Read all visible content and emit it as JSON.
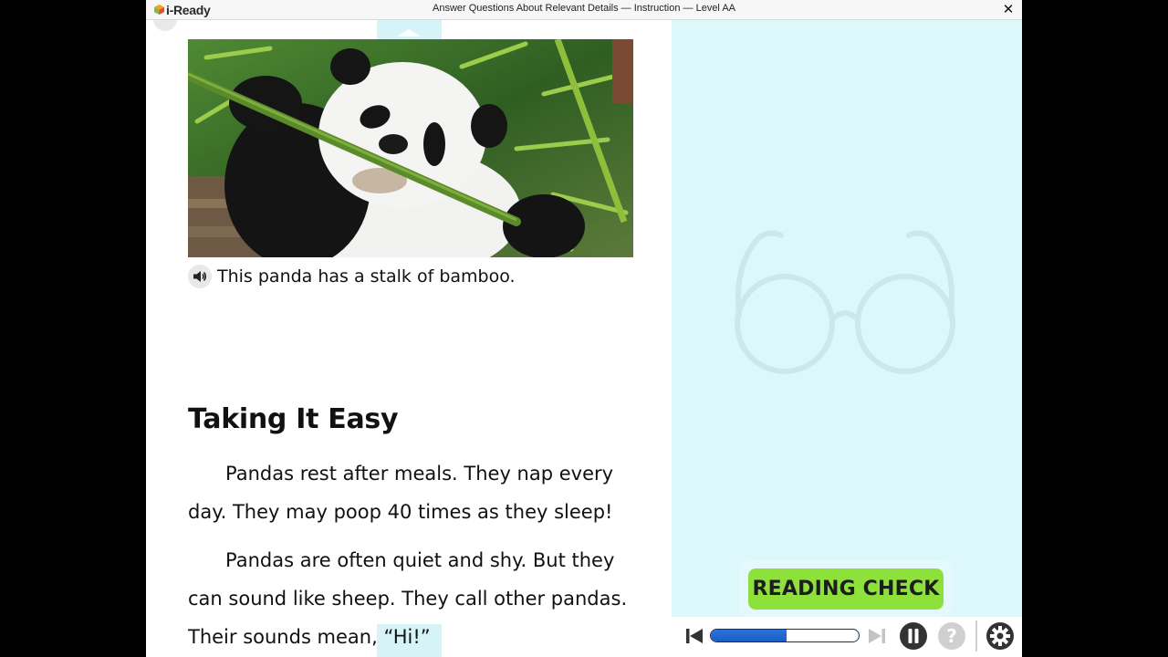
{
  "titlebar": {
    "logo_text": "i-Ready",
    "window_title": "Answer Questions About Relevant Details — Instruction — Level AA",
    "close_glyph": "✕"
  },
  "reading": {
    "image_caption": "This panda has a stalk of bamboo.",
    "heading": "Taking It Easy",
    "paragraphs": [
      "Pandas rest after meals. They nap every day. They may poop 40 times as they sleep!",
      "Pandas are often quiet and shy. But they can sound like sheep. They call other pandas. Their sounds mean, “Hi!”"
    ]
  },
  "side_panel": {
    "reading_check_label": "READING CHECK"
  },
  "controls": {
    "progress": 0.51
  },
  "icons": {
    "logo": "i-ready-cube-logo",
    "close": "close-icon",
    "audio": "speaker-icon",
    "prev": "skip-back-icon",
    "next": "skip-forward-icon",
    "pause": "pause-icon",
    "help": "help-icon",
    "settings": "gear-icon",
    "decor": "glasses-icon"
  },
  "colors": {
    "side_panel_bg": "#dcf8fb",
    "reading_check_bg": "#8ee03a",
    "progress_fill": "#1b5ec6"
  }
}
